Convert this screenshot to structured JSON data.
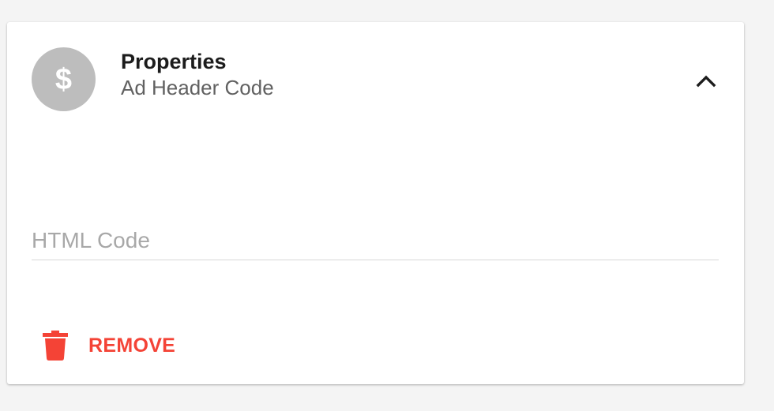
{
  "card": {
    "title": "Properties",
    "subtitle": "Ad Header Code",
    "avatar_glyph": "$",
    "avatar_icon": "dollar-icon",
    "collapse_icon": "chevron-up-icon"
  },
  "html_code_field": {
    "placeholder": "HTML Code",
    "value": ""
  },
  "remove_button": {
    "label": "REMOVE",
    "icon": "trash-icon"
  },
  "colors": {
    "avatar_bg": "#bdbdbd",
    "danger": "#f44336",
    "title": "#1c1c1c",
    "subtitle": "#616161"
  }
}
